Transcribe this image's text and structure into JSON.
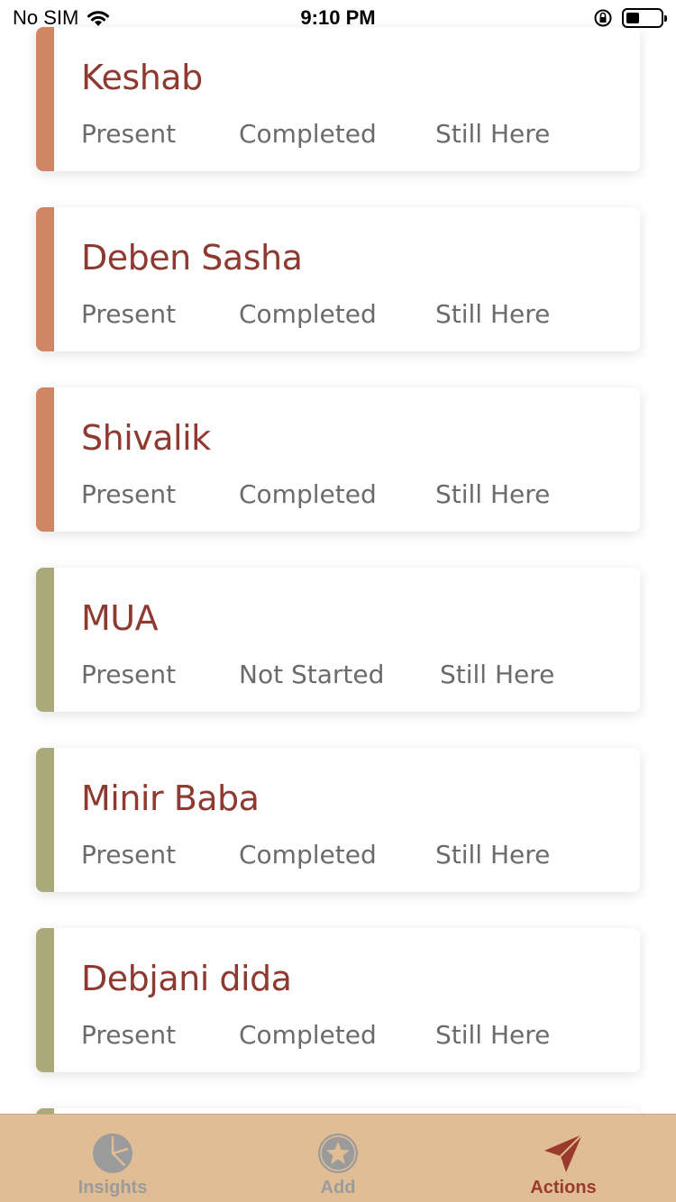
{
  "status_bar": {
    "carrier": "No SIM",
    "time": "9:10 PM"
  },
  "colors": {
    "accent_orange": "#cf8664",
    "accent_olive": "#a9a97a",
    "name_color": "#8f3a30",
    "tab_bar_bg": "#e1bd96",
    "tab_active": "#9a3a2c",
    "tab_inactive": "#9b9b9b"
  },
  "cards": [
    {
      "name": "Keshab",
      "status1": "Present",
      "status2": "Completed",
      "status3": "Still Here",
      "accent": "orange"
    },
    {
      "name": "Deben Sasha",
      "status1": "Present",
      "status2": "Completed",
      "status3": "Still Here",
      "accent": "orange"
    },
    {
      "name": "Shivalik",
      "status1": "Present",
      "status2": "Completed",
      "status3": "Still Here",
      "accent": "orange"
    },
    {
      "name": "MUA",
      "status1": "Present",
      "status2": "Not Started",
      "status3": "Still Here",
      "accent": "olive"
    },
    {
      "name": "Minir Baba",
      "status1": "Present",
      "status2": "Completed",
      "status3": "Still Here",
      "accent": "olive"
    },
    {
      "name": "Debjani dida",
      "status1": "Present",
      "status2": "Completed",
      "status3": "Still Here",
      "accent": "olive"
    }
  ],
  "tabs": [
    {
      "label": "Insights",
      "icon": "pie-chart-icon",
      "active": false
    },
    {
      "label": "Add",
      "icon": "star-icon",
      "active": false
    },
    {
      "label": "Actions",
      "icon": "paper-plane-icon",
      "active": true
    }
  ]
}
